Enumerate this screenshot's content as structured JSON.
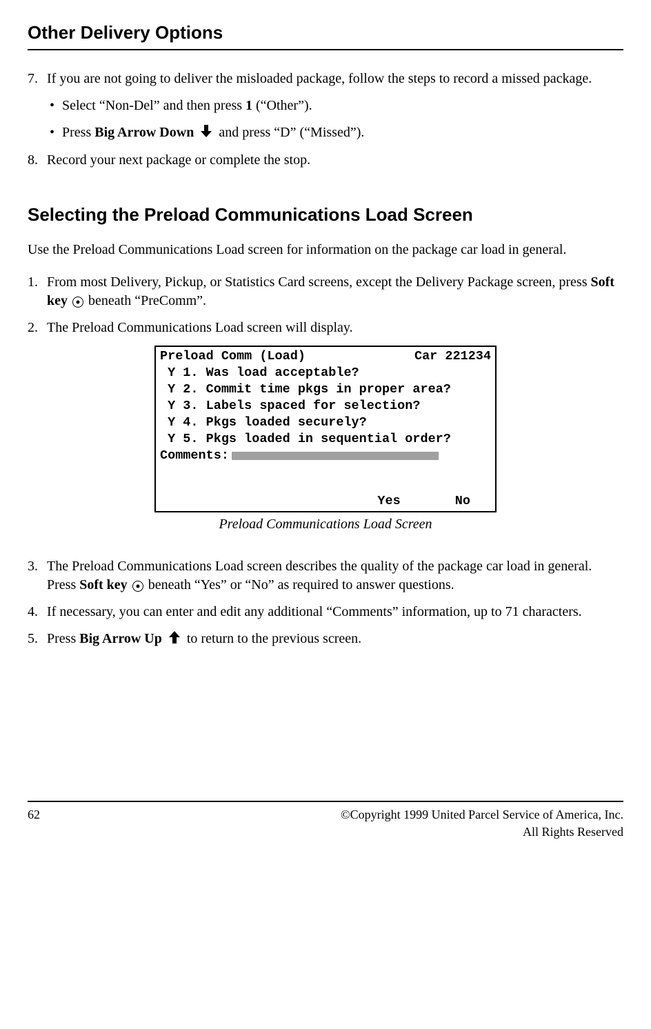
{
  "header": "Other Delivery Options",
  "step7": {
    "num": "7.",
    "text_a": "If you are not going to deliver the misloaded package, follow the steps to record a missed package.",
    "bullet1_a": "Select “Non-Del” and then press ",
    "bullet1_b": "1",
    "bullet1_c": " (“Other”).",
    "bullet2_a": "Press ",
    "bullet2_b": "Big Arrow Down",
    "bullet2_c": "  and press “D” (“Missed”)."
  },
  "step8": {
    "num": "8.",
    "text": "Record your next package or complete the stop."
  },
  "section2": {
    "title": "Selecting the Preload Communications Load Screen",
    "intro": "Use the Preload Communications Load screen for information on the package car load in general.",
    "s1": {
      "num": "1.",
      "a": "From most Delivery, Pickup, or Statistics Card screens, except the Delivery Package screen, press ",
      "b": "Soft key",
      "c": " beneath “PreComm”."
    },
    "s2": {
      "num": "2.",
      "text": "The Preload Communications Load screen will display."
    },
    "screen": {
      "title": "Preload Comm (Load)",
      "car": "Car 221234",
      "l1": " Y 1. Was load acceptable?",
      "l2": " Y 2. Commit time pkgs in proper area?",
      "l3": " Y 3. Labels spaced for selection?",
      "l4": " Y 4. Pkgs loaded securely?",
      "l5": " Y 5. Pkgs loaded in sequential order?",
      "comments_label": "Comments:",
      "yes": "Yes",
      "no": "No"
    },
    "caption": "Preload Communications Load Screen",
    "s3": {
      "num": "3.",
      "a": "The Preload Communications Load screen describes the quality of the package car load in general. Press ",
      "b": "Soft key",
      "c": " beneath “Yes” or “No” as required to answer questions."
    },
    "s4": {
      "num": "4.",
      "text": "If necessary, you can enter and edit any additional “Comments” information, up to 71 characters."
    },
    "s5": {
      "num": "5.",
      "a": "Press ",
      "b": "Big Arrow Up",
      "c": "  to return to the previous screen."
    }
  },
  "footer": {
    "page": "62",
    "copy1": "©Copyright 1999 United Parcel Service of America, Inc.",
    "copy2": "All Rights Reserved"
  }
}
